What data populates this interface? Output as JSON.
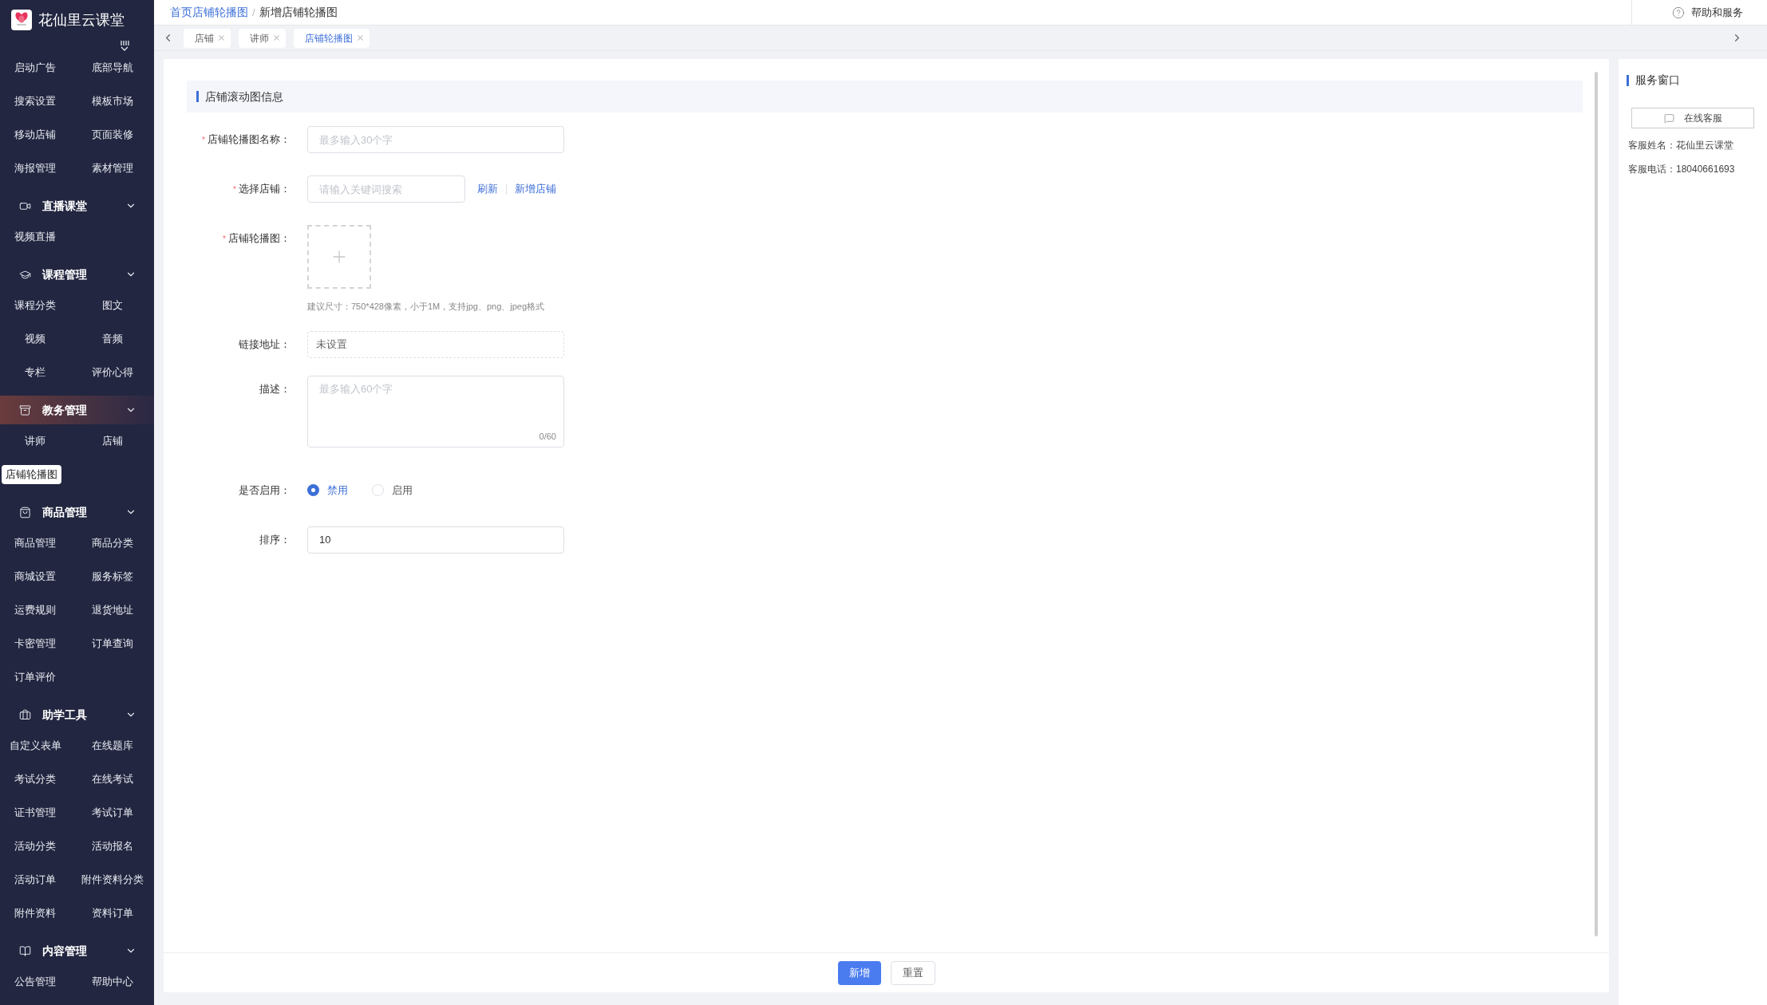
{
  "brand": {
    "name": "花仙里云课堂"
  },
  "sidebar": {
    "top_items": [
      {
        "label": "启动广告",
        "selected": false
      },
      {
        "label": "底部导航",
        "selected": false
      },
      {
        "label": "搜索设置",
        "selected": false
      },
      {
        "label": "模板市场",
        "selected": false
      },
      {
        "label": "移动店铺",
        "selected": false
      },
      {
        "label": "页面装修",
        "selected": false
      },
      {
        "label": "海报管理",
        "selected": false
      },
      {
        "label": "素材管理",
        "selected": false
      }
    ],
    "groups": [
      {
        "title": "直播课堂",
        "selected": false,
        "items": [
          {
            "label": "视频直播",
            "selected": false
          }
        ]
      },
      {
        "title": "课程管理",
        "selected": false,
        "items": [
          {
            "label": "课程分类",
            "selected": false
          },
          {
            "label": "图文",
            "selected": false
          },
          {
            "label": "视频",
            "selected": false
          },
          {
            "label": "音频",
            "selected": false
          },
          {
            "label": "专栏",
            "selected": false
          },
          {
            "label": "评价心得",
            "selected": false
          }
        ]
      },
      {
        "title": "教务管理",
        "selected": true,
        "items": [
          {
            "label": "讲师",
            "selected": false
          },
          {
            "label": "店铺",
            "selected": false
          },
          {
            "label": "店铺轮播图",
            "selected": true
          }
        ]
      },
      {
        "title": "商品管理",
        "selected": false,
        "items": [
          {
            "label": "商品管理",
            "selected": false
          },
          {
            "label": "商品分类",
            "selected": false
          },
          {
            "label": "商城设置",
            "selected": false
          },
          {
            "label": "服务标签",
            "selected": false
          },
          {
            "label": "运费规则",
            "selected": false
          },
          {
            "label": "退货地址",
            "selected": false
          },
          {
            "label": "卡密管理",
            "selected": false
          },
          {
            "label": "订单查询",
            "selected": false
          },
          {
            "label": "订单评价",
            "selected": false
          }
        ]
      },
      {
        "title": "助学工具",
        "selected": false,
        "items": [
          {
            "label": "自定义表单",
            "selected": false
          },
          {
            "label": "在线题库",
            "selected": false
          },
          {
            "label": "考试分类",
            "selected": false
          },
          {
            "label": "在线考试",
            "selected": false
          },
          {
            "label": "证书管理",
            "selected": false
          },
          {
            "label": "考试订单",
            "selected": false
          },
          {
            "label": "活动分类",
            "selected": false
          },
          {
            "label": "活动报名",
            "selected": false
          },
          {
            "label": "活动订单",
            "selected": false
          },
          {
            "label": "附件资料分类",
            "selected": false
          },
          {
            "label": "附件资料",
            "selected": false
          },
          {
            "label": "资料订单",
            "selected": false
          }
        ]
      },
      {
        "title": "内容管理",
        "selected": false,
        "items": [
          {
            "label": "公告管理",
            "selected": false
          },
          {
            "label": "帮助中心",
            "selected": false
          }
        ]
      }
    ]
  },
  "breadcrumb": {
    "link": "首页店铺轮播图",
    "separator": "/",
    "current": "新增店铺轮播图"
  },
  "help": {
    "label": "帮助和服务"
  },
  "tabs": [
    {
      "label": "店铺",
      "selected": false
    },
    {
      "label": "讲师",
      "selected": false
    },
    {
      "label": "店铺轮播图",
      "selected": true
    }
  ],
  "form": {
    "section_title": "店铺滚动图信息",
    "fields": [
      {
        "kind": "text",
        "label": "店铺轮播图名称：",
        "required_mark": "*",
        "placeholder": "最多输入30个字"
      },
      {
        "kind": "search",
        "label": "选择店铺：",
        "required_mark": "*",
        "placeholder": "请输入关键词搜索",
        "links": [
          "刷新",
          "新增店铺"
        ]
      },
      {
        "kind": "upload",
        "label": "店铺轮播图：",
        "required_mark": "*",
        "hint": "建议尺寸：750*428像素，小于1M，支持jpg、png、jpeg格式"
      },
      {
        "kind": "link",
        "label": "链接地址：",
        "value": "未设置"
      },
      {
        "kind": "textarea",
        "label": "描述：",
        "placeholder": "最多输入60个字",
        "counter": "0/60"
      },
      {
        "kind": "radio",
        "label": "是否启用：",
        "options": [
          {
            "label": "禁用",
            "selected": true
          },
          {
            "label": "启用",
            "selected": false
          }
        ]
      },
      {
        "kind": "text",
        "label": "排序：",
        "value": "10"
      }
    ]
  },
  "footer": {
    "buttons": [
      {
        "label": "新增",
        "kind": "primary"
      },
      {
        "label": "重置",
        "kind": "default"
      }
    ]
  },
  "service": {
    "title": "服务窗口",
    "button": "在线客服",
    "lines": [
      "客服姓名：花仙里云课堂",
      "客服电话：18040661693"
    ]
  }
}
